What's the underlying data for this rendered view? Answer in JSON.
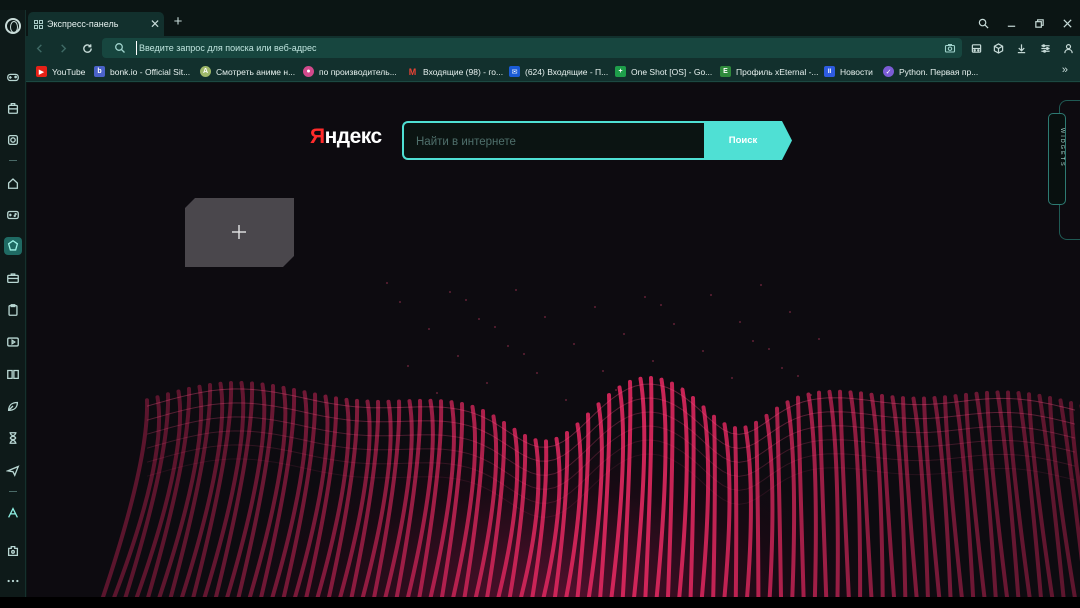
{
  "tab": {
    "title": "Экспресс-панель",
    "close": "✕",
    "new": "+"
  },
  "address": {
    "placeholder": "Введите запрос для поиска или веб-адрес"
  },
  "bookmarks": [
    {
      "label": "YouTube",
      "fav_color": "#e62117",
      "fav_text": "▶"
    },
    {
      "label": "bonk.io - Official Sit...",
      "fav_color": "#4a62c9",
      "fav_text": "b"
    },
    {
      "label": "Смотреть аниме н...",
      "fav_color": "#9fb86a",
      "fav_text": "A"
    },
    {
      "label": "по производитель...",
      "fav_color": "#d24a8c",
      "fav_text": "●"
    },
    {
      "label": "Входящие (98) - го...",
      "fav_color": "#1b1b1b",
      "fav_text": "M"
    },
    {
      "label": "(624) Входящие - П...",
      "fav_color": "#1a5bd6",
      "fav_text": "✉"
    },
    {
      "label": "One Shot [OS] - Go...",
      "fav_color": "#1e9e4a",
      "fav_text": "+"
    },
    {
      "label": "Профиль xEternal -...",
      "fav_color": "#2f8a3c",
      "fav_text": "E"
    },
    {
      "label": "Новости",
      "fav_color": "#2d5be0",
      "fav_text": "II"
    },
    {
      "label": "Python. Первая пр...",
      "fav_color": "#7b5cd6",
      "fav_text": "✓"
    }
  ],
  "bookmarks_more": "»",
  "yandex": {
    "logo_first": "Я",
    "logo_rest": "ндекс",
    "search_placeholder": "Найти в интернете",
    "search_button": "Поиск"
  },
  "speed_dial": {
    "add_label": "+"
  },
  "widgets": {
    "label": "WIDGETS"
  },
  "colors": {
    "accent": "#4fe0d4",
    "sidebar_active": "#1f6a63",
    "wave": "#e0285f"
  }
}
